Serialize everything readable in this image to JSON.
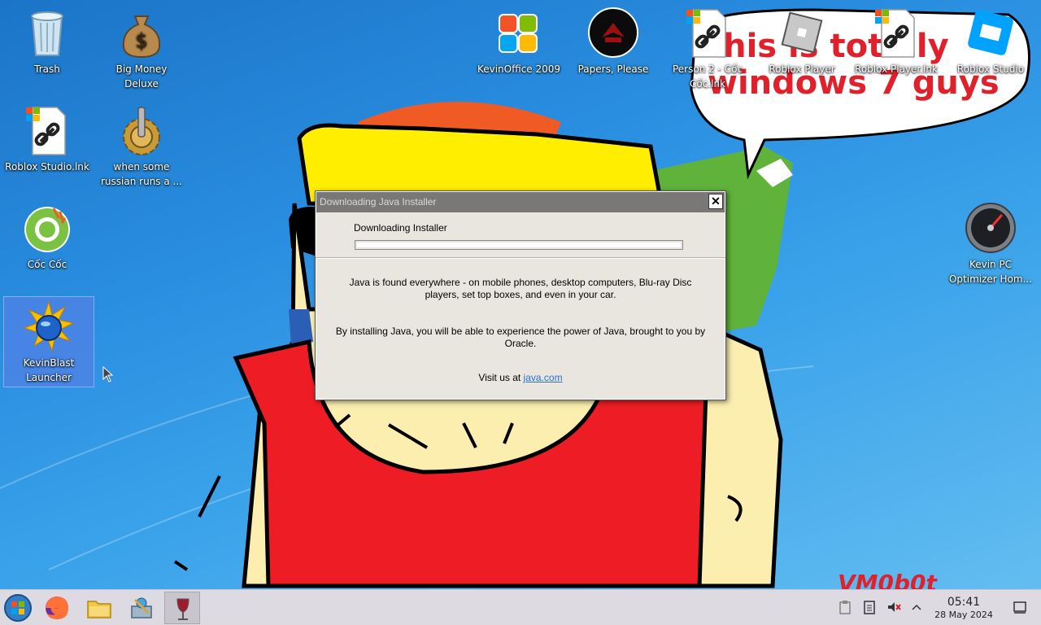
{
  "desktop": {
    "icons": [
      {
        "label": "Trash"
      },
      {
        "label": "Big Money Deluxe"
      },
      {
        "label": "Roblox Studio.lnk"
      },
      {
        "label": "when some russian runs a ..."
      },
      {
        "label": "Cốc Cốc"
      },
      {
        "label": "KevinBlast Launcher"
      },
      {
        "label": "KevinOffice 2009"
      },
      {
        "label": "Papers, Please"
      },
      {
        "label": "Person 2 - Cốc Cốc.lnk"
      },
      {
        "label": "Roblox Player"
      },
      {
        "label": "Roblox Player.lnk"
      },
      {
        "label": "Roblox Studio"
      },
      {
        "label": "Kevin PC Optimizer Hom..."
      }
    ]
  },
  "wallpaper": {
    "speech_text_1": "this is totally",
    "speech_text_2": "windows 7 guys",
    "signature": "VM0b0t"
  },
  "dialog": {
    "title": "Downloading Java Installer",
    "close_glyph": "✕",
    "status": "Downloading Installer",
    "progress_fraction": 0.0,
    "paragraph1": "Java is found everywhere - on mobile phones, desktop computers, Blu-ray Disc players, set top boxes, and even in your car.",
    "paragraph2": "By installing Java, you will be able to experience the power of Java, brought to you by Oracle.",
    "visit_prefix": "Visit us at ",
    "visit_link": "java.com"
  },
  "taskbar": {
    "buttons": [
      "start-menu",
      "firefox",
      "file-manager",
      "network-tool",
      "wine-app"
    ],
    "clock_time": "05:41",
    "clock_date": "28 May 2024"
  },
  "colors": {
    "desktop_bg": "#2a8ee0",
    "dialog_bg": "#e8e6df",
    "titlebar": "#797877",
    "link": "#2a6fd0",
    "taskbar": "#dad7e0"
  }
}
